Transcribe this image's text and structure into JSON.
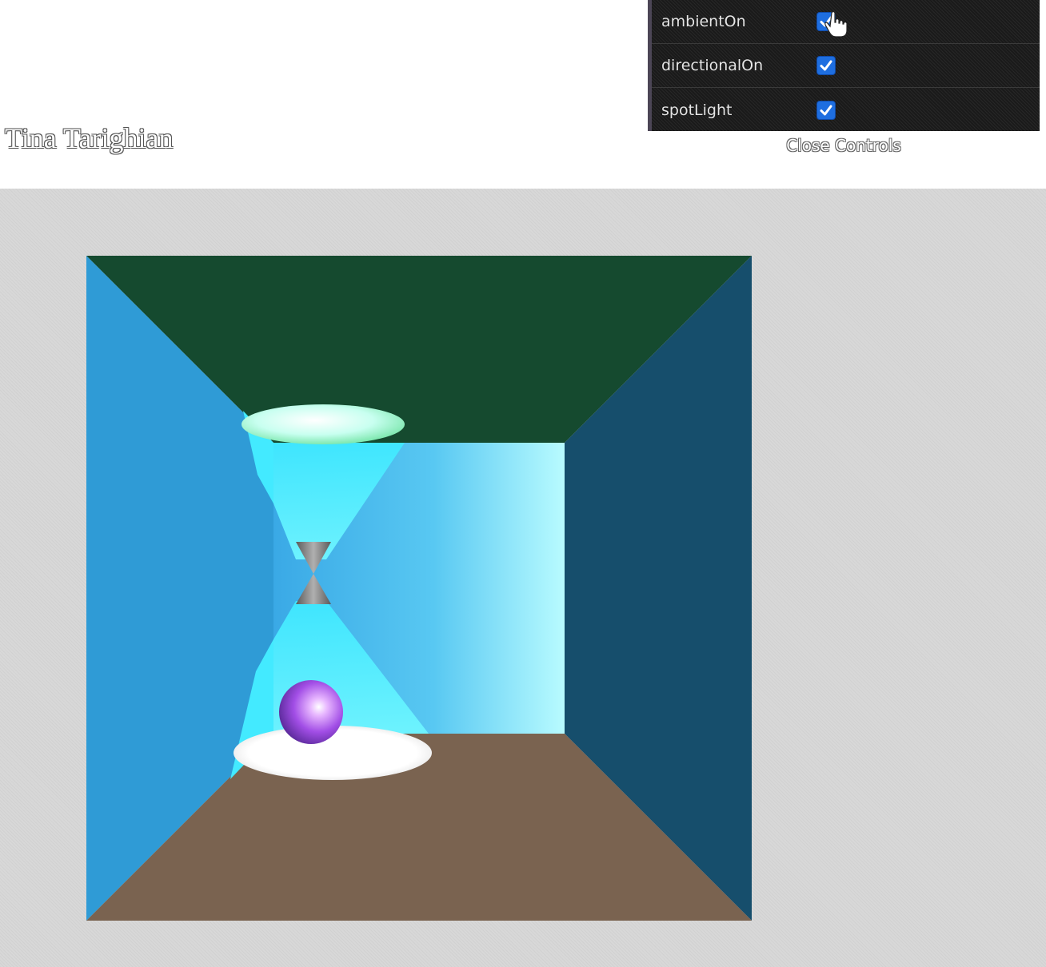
{
  "page": {
    "author": "Tina Tarighian"
  },
  "controls": {
    "items": [
      {
        "label": "ambientOn",
        "checked": true
      },
      {
        "label": "directionalOn",
        "checked": true
      },
      {
        "label": "spotLight",
        "checked": true
      }
    ],
    "close_label": "Close Controls"
  },
  "scene": {
    "colors": {
      "ceiling": "#154a2f",
      "left_wall": "#2f9bd6",
      "right_wall": "#164e6c",
      "back_wall": "#4fd6f0",
      "floor": "#7a6350",
      "sphere": "#9b4fe0",
      "cone": "#8a8a8a"
    }
  }
}
